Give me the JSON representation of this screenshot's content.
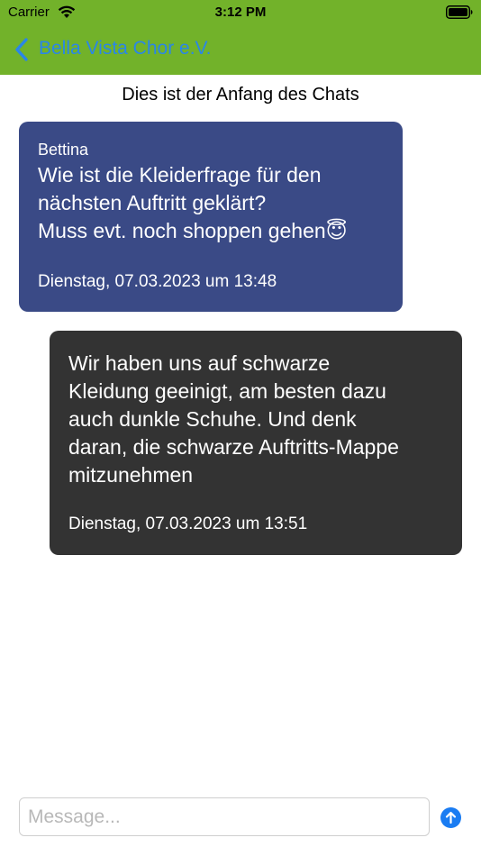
{
  "status_bar": {
    "carrier": "Carrier",
    "time": "3:12 PM"
  },
  "nav": {
    "title": "Bella Vista Chor e.V."
  },
  "chat": {
    "start_label": "Dies ist der Anfang des Chats",
    "messages": [
      {
        "sender": "Bettina",
        "text": "Wie ist die Kleiderfrage für den\nnächsten Auftritt geklärt?\nMuss evt. noch shoppen gehen😇",
        "timestamp": "Dienstag, 07.03.2023 um 13:48"
      },
      {
        "sender": "",
        "text": "Wir haben uns auf schwarze\nKleidung geeinigt, am besten dazu\nauch dunkle Schuhe. Und denk\ndaran, die schwarze Auftritts-Mappe\nmitzunehmen",
        "timestamp": "Dienstag, 07.03.2023 um 13:51"
      }
    ]
  },
  "composer": {
    "placeholder": "Message..."
  },
  "colors": {
    "nav_background": "#72b22a",
    "accent": "#2a86e8",
    "incoming_bubble": "#3a4a86",
    "outgoing_bubble": "#333333",
    "send_button": "#1a7cf2"
  }
}
